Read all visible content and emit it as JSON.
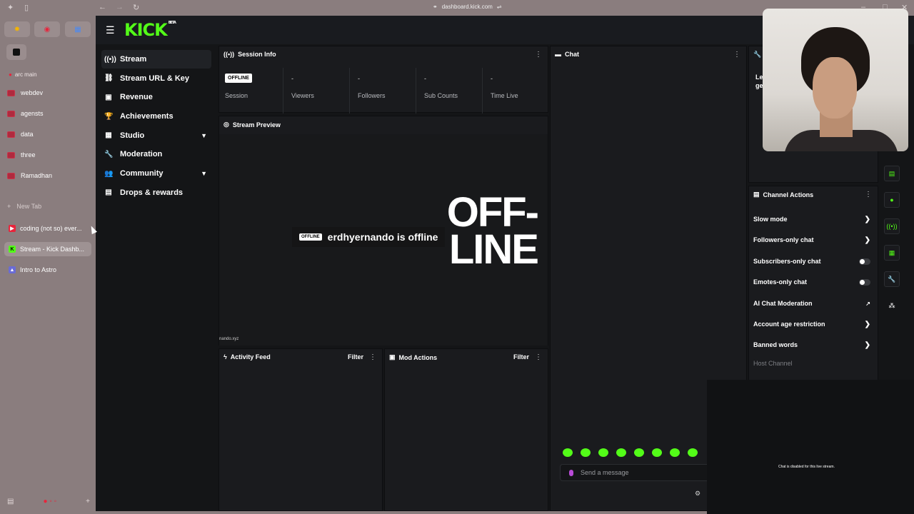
{
  "browser": {
    "url": "dashboard.kick.com",
    "space_label": "arc main",
    "folders": [
      "webdev",
      "agensts",
      "data",
      "three",
      "Ramadhan"
    ],
    "new_tab": "New Tab",
    "tabs": [
      {
        "label": "coding (not so) ever...",
        "icon_color": "#e8243b"
      },
      {
        "label": "Stream - Kick Dashb...",
        "icon_color": "#53fc18",
        "active": true
      },
      {
        "label": "Intro to Astro",
        "icon_color": "#6a6cd6"
      }
    ]
  },
  "kick": {
    "logo": "KICK",
    "logo_badge": "BETA",
    "accent": "#53fc18",
    "nav": [
      {
        "label": "Stream",
        "icon": "broadcast-icon",
        "glyph": "((•))",
        "active": true
      },
      {
        "label": "Stream URL & Key",
        "icon": "link-icon",
        "glyph": "⛓"
      },
      {
        "label": "Revenue",
        "icon": "revenue-icon",
        "glyph": "▣"
      },
      {
        "label": "Achievements",
        "icon": "trophy-icon",
        "glyph": "🏆"
      },
      {
        "label": "Studio",
        "icon": "studio-icon",
        "glyph": "▦",
        "expandable": true
      },
      {
        "label": "Moderation",
        "icon": "wrench-icon",
        "glyph": "🔧"
      },
      {
        "label": "Community",
        "icon": "community-icon",
        "glyph": "👥",
        "expandable": true
      },
      {
        "label": "Drops & rewards",
        "icon": "drops-icon",
        "glyph": "▤"
      }
    ],
    "session_info": {
      "title": "Session Info",
      "offline_badge": "OFFLINE",
      "session_label": "Session",
      "stats": [
        {
          "value": "-",
          "label": "Viewers"
        },
        {
          "value": "-",
          "label": "Followers"
        },
        {
          "value": "-",
          "label": "Sub Counts"
        },
        {
          "value": "-",
          "label": "Time Live"
        }
      ]
    },
    "preview": {
      "title": "Stream Preview",
      "offline_line1": "OFF-",
      "offline_line2": "LINE",
      "offline_badge": "OFFLINE",
      "offline_message": "erdhyernando is offline",
      "watermark": "nando.xyz"
    },
    "activity_feed": {
      "title": "Activity Feed",
      "filter": "Filter"
    },
    "mod_actions": {
      "title": "Mod Actions",
      "filter": "Filter"
    },
    "chat": {
      "title": "Chat",
      "placeholder": "Send a message",
      "disabled_notice": "Chat is disabled for this live stream."
    },
    "channel_actions": {
      "title": "Channel Actions",
      "items": [
        {
          "label": "Slow mode",
          "control": "arrow"
        },
        {
          "label": "Followers-only chat",
          "control": "arrow"
        },
        {
          "label": "Subscribers-only chat",
          "control": "toggle"
        },
        {
          "label": "Emotes-only chat",
          "control": "toggle"
        },
        {
          "label": "AI Chat Moderation",
          "control": "external"
        },
        {
          "label": "Account age restriction",
          "control": "arrow"
        },
        {
          "label": "Banned words",
          "control": "arrow"
        }
      ],
      "host_channel": "Host Channel"
    },
    "top_right_panel": {
      "partial_text_1": "Le",
      "partial_text_2": "ge"
    }
  }
}
